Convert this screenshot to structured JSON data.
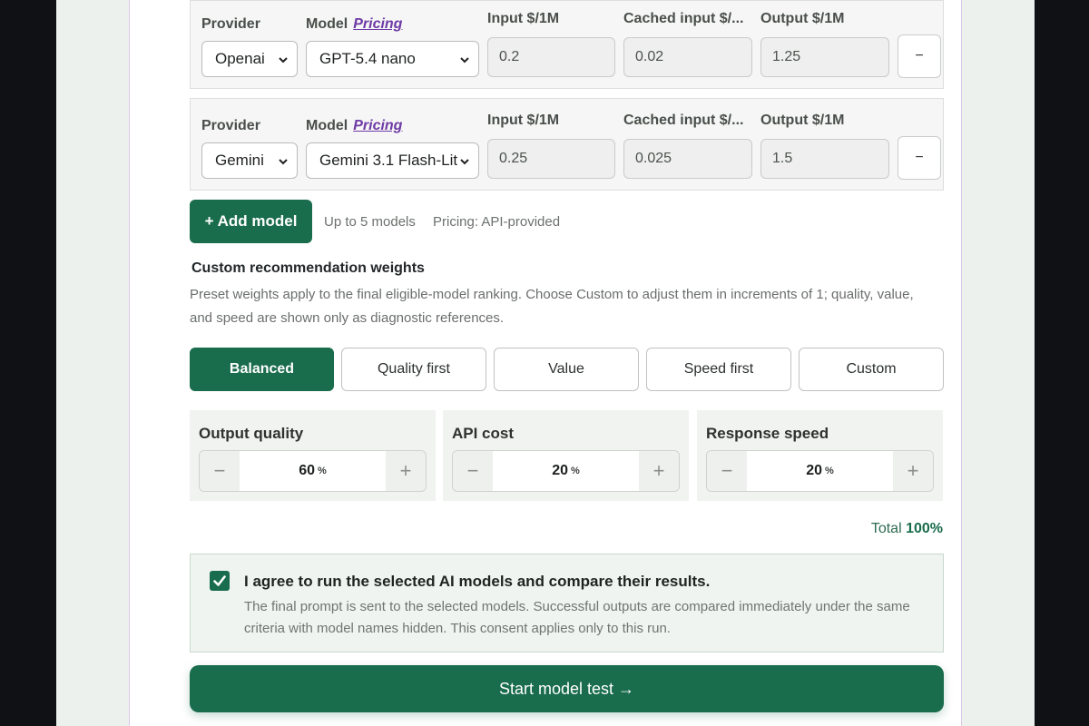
{
  "models": [
    {
      "provider_label": "Provider",
      "provider": "Openai",
      "model_label": "Model",
      "pricing_link": "Pricing",
      "model": "GPT-5.4 nano",
      "input_label": "Input $/1M",
      "input": "0.2",
      "cached_label": "Cached input $/...",
      "cached": "0.02",
      "output_label": "Output $/1M",
      "output": "1.25",
      "remove_label": "−"
    },
    {
      "provider_label": "Provider",
      "provider": "Gemini",
      "model_label": "Model",
      "pricing_link": "Pricing",
      "model": "Gemini 3.1 Flash-Lit",
      "input_label": "Input $/1M",
      "input": "0.25",
      "cached_label": "Cached input $/...",
      "cached": "0.025",
      "output_label": "Output $/1M",
      "output": "1.5",
      "remove_label": "−"
    }
  ],
  "add_model": {
    "label": "+ Add model",
    "limit_hint": "Up to 5 models",
    "pricing_hint": "Pricing: API-provided"
  },
  "weights": {
    "title": "Custom recommendation weights",
    "description": "Preset weights apply to the final eligible-model ranking. Choose Custom to adjust them in increments of 1; quality, value, and speed are shown only as diagnostic references.",
    "presets": [
      "Balanced",
      "Quality first",
      "Value",
      "Speed first",
      "Custom"
    ],
    "active_preset": "Balanced",
    "items": [
      {
        "label": "Output quality",
        "value": "60",
        "unit": "%"
      },
      {
        "label": "API cost",
        "value": "20",
        "unit": "%"
      },
      {
        "label": "Response speed",
        "value": "20",
        "unit": "%"
      }
    ],
    "total_label": "Total",
    "total_value": "100%"
  },
  "consent": {
    "checked": true,
    "title": "I agree to run the selected AI models and compare their results.",
    "text": "The final prompt is sent to the selected models. Successful outputs are compared immediately under the same criteria with model names hidden. This consent applies only to this run."
  },
  "start_button": "Start model test →",
  "colors": {
    "accent": "#196c4c",
    "link": "#6f3aa6",
    "card_bg": "#ffffff",
    "page_bg": "#edf1ee"
  }
}
